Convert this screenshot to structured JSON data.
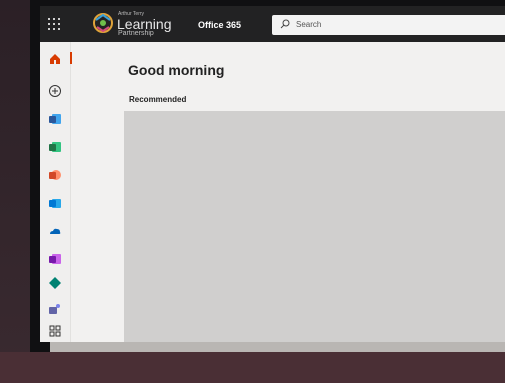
{
  "header": {
    "logo_small": "Arthur Terry",
    "logo_big": "Learning",
    "logo_sub": "Partnership",
    "app_name": "Office 365",
    "search_placeholder": "Search"
  },
  "main": {
    "greeting": "Good morning",
    "section_title": "Recommended"
  },
  "rail": {
    "items": [
      "home-icon",
      "create-icon",
      "word-icon",
      "excel-icon",
      "powerpoint-icon",
      "outlook-icon",
      "onedrive-icon",
      "onenote-icon",
      "sway-icon",
      "teams-icon",
      "all-apps-icon"
    ]
  },
  "colors": {
    "topbar": "#222223",
    "accent": "#d83b01",
    "word": "#2b579a",
    "excel": "#217346",
    "powerpoint": "#d24726",
    "outlook": "#0078d4",
    "onedrive": "#0364b8",
    "onenote": "#7719aa",
    "sway": "#008272",
    "teams": "#6264a7"
  }
}
